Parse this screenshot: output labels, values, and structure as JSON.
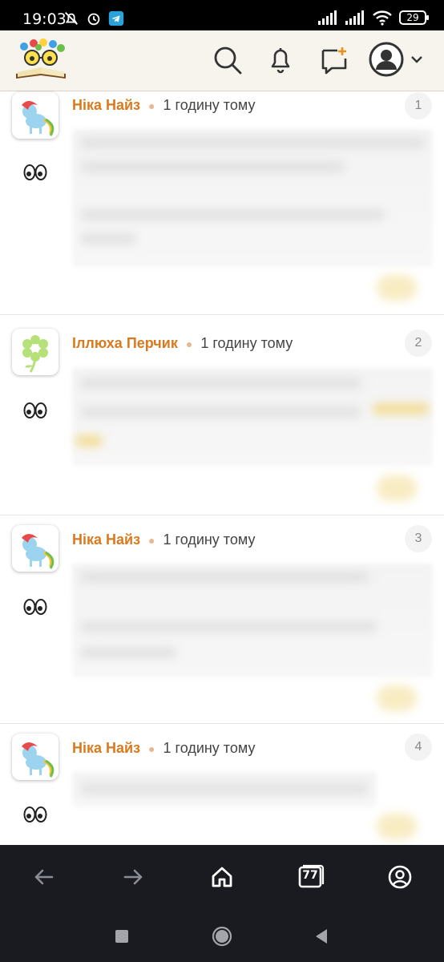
{
  "status_bar": {
    "time": "19:03",
    "battery": "29"
  },
  "header": {
    "logo": "book-with-glasses-logo",
    "icons": [
      "search-icon",
      "bell-icon",
      "new-message-icon",
      "account-avatar-icon",
      "chevron-down-icon"
    ]
  },
  "comments": [
    {
      "author": "Ніка Найз",
      "time_ago": "1 годину тому",
      "number": "1"
    },
    {
      "author": "Іллюха Перчик",
      "time_ago": "1 годину тому",
      "number": "2"
    },
    {
      "author": "Ніка Найз",
      "time_ago": "1 годину тому",
      "number": "3"
    },
    {
      "author": "Ніка Найз",
      "time_ago": "1 годину тому",
      "number": "4"
    }
  ],
  "browser_nav": [
    "back-arrow-icon",
    "forward-arrow-icon",
    "home-icon",
    "tabs-icon",
    "profile-icon"
  ],
  "browser_tabs_count": "77",
  "colors": {
    "author": "#d97a1e",
    "header_bg": "#f7f4ee",
    "nav_bg": "#191b21"
  }
}
